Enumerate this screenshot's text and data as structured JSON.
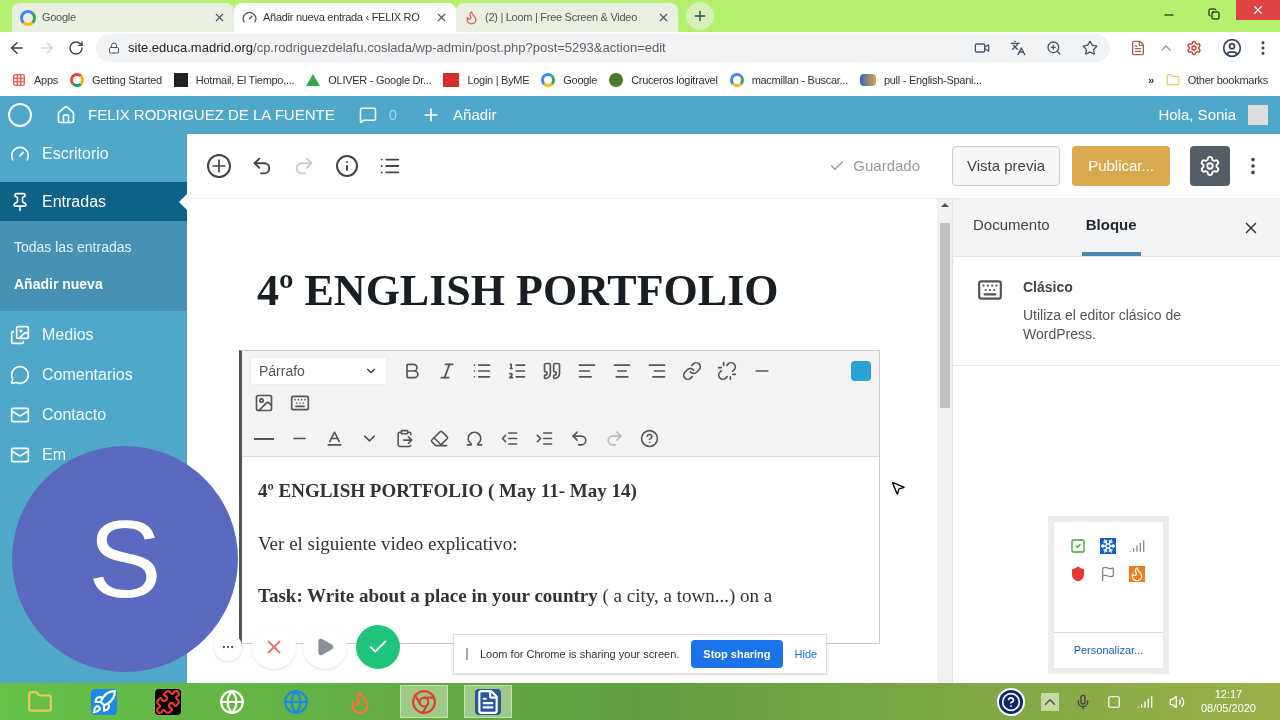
{
  "browser": {
    "tabs": [
      {
        "title": "Google",
        "selected": false,
        "kind": "google"
      },
      {
        "title": "Añadir nueva entrada ‹ FELIX RO",
        "selected": true,
        "kind": "wp"
      },
      {
        "title": "(2) | Loom | Free Screen & Video",
        "selected": false,
        "kind": "loom"
      }
    ],
    "url_host": "site.educa.madrid.org",
    "url_path": "/cp.rodriguezdelafu.coslada/wp-admin/post.php?post=5293&action=edit",
    "bookmarks": [
      {
        "label": "Apps",
        "kind": "apps"
      },
      {
        "label": "Getting Started",
        "kind": "chrome"
      },
      {
        "label": "Hotmail, El Tiempo,...",
        "kind": "dark"
      },
      {
        "label": "OLIVER - Google Dr...",
        "kind": "drive"
      },
      {
        "label": "Login | ByME",
        "kind": "me"
      },
      {
        "label": "Google",
        "kind": "google"
      },
      {
        "label": "Cruceros logitravel",
        "kind": "turtle"
      },
      {
        "label": "macmillan - Buscar...",
        "kind": "google"
      },
      {
        "label": "pull - English-Spani...",
        "kind": "wr"
      }
    ],
    "more_bookmarks": "»",
    "other_bookmarks": "Other bookmarks"
  },
  "admin_bar": {
    "site": "FELIX RODRIGUEZ DE LA FUENTE",
    "comments": "0",
    "add": "Añadir",
    "greeting": "Hola, Sonia"
  },
  "menu": [
    {
      "label": "Escritorio",
      "selected": false,
      "kind": "gauge"
    },
    {
      "label": "Entradas",
      "selected": true,
      "kind": "pin",
      "children": [
        {
          "label": "Todas las entradas",
          "selected": false
        },
        {
          "label": "Añadir nueva",
          "selected": true
        }
      ]
    },
    {
      "label": "Medios",
      "selected": false,
      "kind": "media"
    },
    {
      "label": "Comentarios",
      "selected": false,
      "kind": "comment"
    },
    {
      "label": "Contacto",
      "selected": false,
      "kind": "mail"
    },
    {
      "label": "Em",
      "selected": false,
      "kind": "mail"
    }
  ],
  "header": {
    "status": "Guardado",
    "preview": "Vista previa",
    "publish": "Publicar..."
  },
  "post_title": "4º ENGLISH PORTFOLIO",
  "classic": {
    "format": "Párrafo",
    "paragraphs": [
      {
        "text": "4º ENGLISH PORTFOLIO ( May 11- May 14)",
        "bold": true
      },
      {
        "text": "Ver el siguiente video explicativo:",
        "bold": false
      },
      {
        "text": "**Task: Write about a place in your country** ( a city, a town...) on a",
        "bold": false
      }
    ]
  },
  "settings": {
    "tabs": [
      {
        "label": "Documento",
        "selected": false
      },
      {
        "label": "Bloque",
        "selected": true
      }
    ],
    "block_name": "Clásico",
    "block_description": "Utiliza el editor clásico de WordPress."
  },
  "loom": {
    "avatar": "S",
    "message": "Loom for Chrome is sharing your screen.",
    "stop": "Stop sharing",
    "hide": "Hide"
  },
  "tray": {
    "customize": "Personalizar..."
  },
  "taskbar": {
    "apps": [
      {
        "kind": "folder",
        "active": false
      },
      {
        "kind": "rocket",
        "active": false
      },
      {
        "kind": "puzzle",
        "active": false
      },
      {
        "kind": "hp",
        "active": false
      },
      {
        "kind": "ie",
        "active": false
      },
      {
        "kind": "firefox",
        "active": false
      },
      {
        "kind": "chrome",
        "active": true
      },
      {
        "kind": "word",
        "active": true
      }
    ],
    "time": "12:17",
    "date": "08/05/2020"
  }
}
